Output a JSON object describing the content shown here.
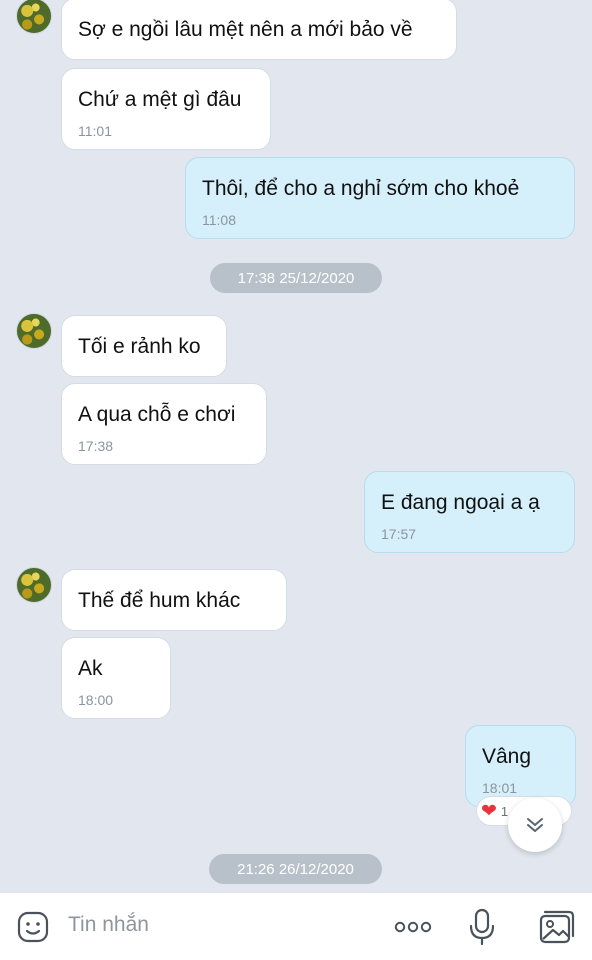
{
  "messages": [
    {
      "side": "them",
      "text": "Sợ e ngồi lâu mệt nên a mới bảo về",
      "time": ""
    },
    {
      "side": "them",
      "text": "Chứ a mệt gì đâu",
      "time": "11:01"
    },
    {
      "side": "me",
      "text": "Thôi, để cho a nghỉ sớm cho khoẻ",
      "time": "11:08"
    },
    {
      "side": "them",
      "text": "Tối e rảnh ko",
      "time": ""
    },
    {
      "side": "them",
      "text": "A qua chỗ e chơi",
      "time": "17:38"
    },
    {
      "side": "me",
      "text": "E đang ngoại a ạ",
      "time": "17:57"
    },
    {
      "side": "them",
      "text": "Thế để hum khác",
      "time": ""
    },
    {
      "side": "them",
      "text": "Ak",
      "time": "18:00"
    },
    {
      "side": "me",
      "text": "Vâng",
      "time": "18:01"
    }
  ],
  "date_separators": [
    "17:38 25/12/2020",
    "21:26 26/12/2020"
  ],
  "reaction": {
    "emoji": "❤",
    "count": "1"
  },
  "input": {
    "placeholder": "Tin nhắn"
  },
  "colors": {
    "background": "#e2e7ef",
    "my_bubble": "#d5f0fb",
    "their_bubble": "#ffffff",
    "heart": "#e8323c"
  },
  "icons": [
    "sticker-icon",
    "more-icon",
    "microphone-icon",
    "image-icon",
    "chevron-double-down-icon"
  ]
}
